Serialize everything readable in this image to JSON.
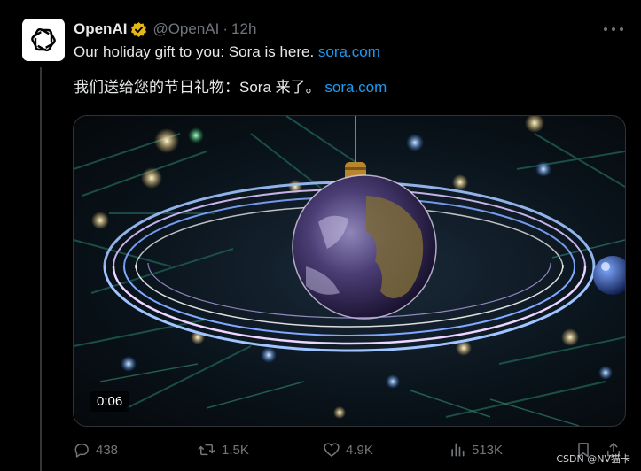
{
  "tweet": {
    "display_name": "OpenAI",
    "handle": "@OpenAI",
    "separator": "·",
    "time": "12h",
    "line1_text": "Our holiday gift to you: Sora is here. ",
    "line1_link": "sora.com",
    "line2_text": "我们送给您的节日礼物：Sora 来了。 ",
    "line2_link": "sora.com"
  },
  "media": {
    "duration": "0:06"
  },
  "actions": {
    "replies": "438",
    "reposts": "1.5K",
    "likes": "4.9K",
    "views": "513K"
  },
  "watermark": "CSDN @NV猫卡",
  "colors": {
    "background": "#000000",
    "text": "#e7e9ea",
    "muted": "#71767b",
    "link": "#1d9bf0",
    "verified": "#e2b719"
  },
  "icons": {
    "avatar": "openai-logo-icon",
    "verified": "verified-badge-icon",
    "more": "more-icon",
    "reply": "reply-icon",
    "repost": "repost-icon",
    "like": "heart-icon",
    "views": "views-icon",
    "bookmark": "bookmark-icon",
    "share": "share-icon"
  }
}
